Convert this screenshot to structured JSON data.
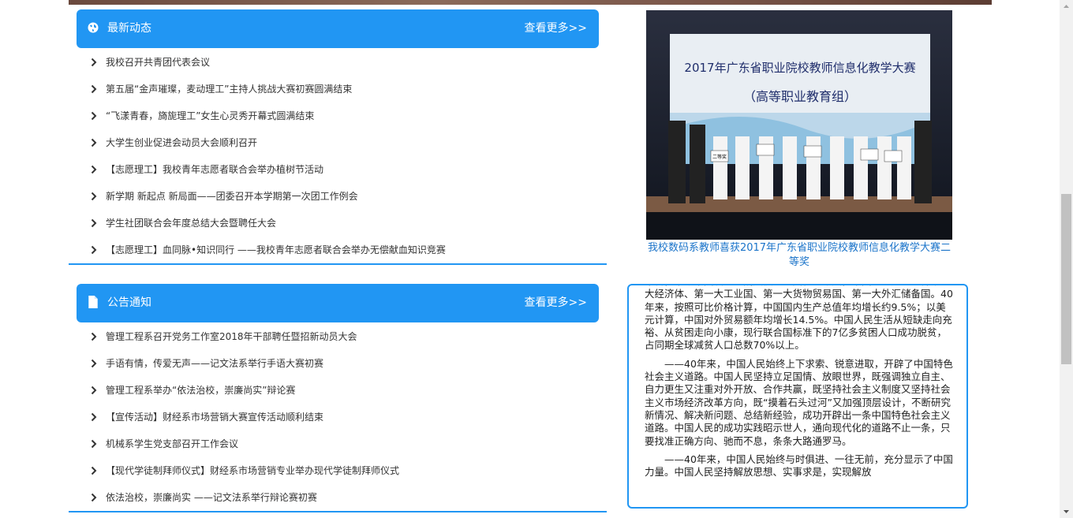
{
  "news_panel": {
    "title": "最新动态",
    "more": "查看更多>>",
    "items": [
      "我校召开共青团代表会议",
      "第五届“金声璀璨，麦动理工”主持人挑战大赛初赛圆满结束",
      "“飞漾青春，旖旎理工”女生心灵秀开幕式圆满结束",
      "大学生创业促进会动员大会顺利召开",
      "【志愿理工】我校青年志愿者联合会举办植树节活动",
      "新学期 新起点 新局面——团委召开本学期第一次团工作例会",
      "学生社团联合会年度总结大会暨聘任大会",
      "【志愿理工】血同脉•知识同行 ——我校青年志愿者联合会举办无偿献血知识竞赛"
    ]
  },
  "notice_panel": {
    "title": "公告通知",
    "more": "查看更多>>",
    "items": [
      "管理工程系召开党务工作室2018年干部聘任暨招新动员大会",
      "手语有情，传爱无声——记文法系举行手语大赛初赛",
      "管理工程系举办“依法治校，崇廉尚实”辩论赛",
      "【宣传活动】财经系市场营销大赛宣传活动顺利结束",
      "机械系学生党支部召开工作会议",
      "【现代学徒制拜师仪式】财经系市场营销专业举办现代学徒制拜师仪式",
      "依法治校，崇廉尚实 ——记文法系举行辩论赛初赛"
    ]
  },
  "photo": {
    "banner_title": "2017年广东省职业院校教师信息化教学大赛",
    "banner_subtitle": "（高等职业教育组）",
    "caption": "我校数码系教师喜获2017年广东省职业院校教师信息化教学大赛二等奖",
    "award_label": "二等奖"
  },
  "article": {
    "paragraphs": [
      "不舍，推动中国发生了翻天覆地的变化。今天，中国已经成为世界第二大经济体、第一大工业国、第一大货物贸易国、第一大外汇储备国。40年来，按照可比价格计算，中国国内生产总值年均增长约9.5%；以美元计算，中国对外贸易额年均增长14.5%。中国人民生活从短缺走向充裕、从贫困走向小康，现行联合国标准下的7亿多贫困人口成功脱贫，占同期全球减贫人口总数70%以上。",
      "——40年来，中国人民始终上下求索、锐意进取，开辟了中国特色社会主义道路。中国人民坚持立足国情、放眼世界，既强调独立自主、自力更生又注重对外开放、合作共赢，既坚持社会主义制度又坚持社会主义市场经济改革方向，既“摸着石头过河”又加强顶层设计，不断研究新情况、解决新问题、总结新经验，成功开辟出一条中国特色社会主义道路。中国人民的成功实践昭示世人，通向现代化的道路不止一条，只要找准正确方向、驰而不息，条条大路通罗马。",
      "——40年来，中国人民始终与时俱进、一往无前，充分显示了中国力量。中国人民坚持解放思想、实事求是，实现解放"
    ]
  },
  "colors": {
    "accent": "#2196f3",
    "caption": "#1a73c9",
    "scroll_track": "#f1f1f1",
    "scroll_thumb": "#c1c1c1"
  }
}
